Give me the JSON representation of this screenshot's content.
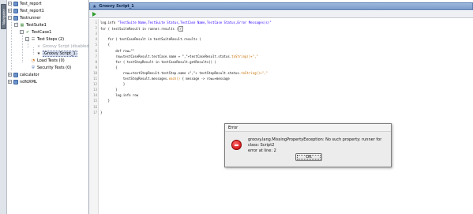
{
  "sidebar": {
    "vertical_tab": "Navigator"
  },
  "tree": {
    "items": [
      {
        "label": "Test_report",
        "icon": "project-icon",
        "expander": "−"
      },
      {
        "label": "Test_report1",
        "icon": "project-icon",
        "expander": "+"
      },
      {
        "label": "Testrunner",
        "icon": "project-icon",
        "expander": "−"
      },
      {
        "label": "TestSuite1",
        "icon": "testsuite-icon",
        "expander": "−"
      },
      {
        "label": "TestCase1",
        "icon": "testcase-icon",
        "expander": "−"
      },
      {
        "label": "Test Steps (2)",
        "icon": "teststeps-icon",
        "expander": "−"
      },
      {
        "label": "Groovy Script (disabled)",
        "icon": "groovy-icon",
        "expander": ""
      },
      {
        "label": "Groovy Script_1",
        "icon": "groovy-icon",
        "expander": ""
      },
      {
        "label": "Load Tests (0)",
        "icon": "loadtest-icon",
        "expander": ""
      },
      {
        "label": "Security Tests (0)",
        "icon": "securitytest-icon",
        "expander": ""
      },
      {
        "label": "calculator",
        "icon": "project-icon",
        "expander": "+"
      },
      {
        "label": "ndfdXML",
        "icon": "project-icon",
        "expander": "+"
      }
    ]
  },
  "editor": {
    "title": "Groovy Script_1",
    "code_lines": [
      {
        "n": "1",
        "pre": "log.info ",
        "str": "\"TestSuite Name,TestSuite Status,TestCase Name,TestCase Status,Error Messages(s)\"",
        "post": ""
      },
      {
        "n": "2",
        "pre": "for ( testSuiteResult in runner.results )",
        "str": "",
        "post": ""
      },
      {
        "n": "3",
        "pre": "",
        "str": "",
        "post": ""
      },
      {
        "n": "4",
        "pre": "    for ( testCaseResult in testSuiteResult.results )",
        "str": "",
        "post": ""
      },
      {
        "n": "5",
        "pre": "    {",
        "str": "",
        "post": ""
      },
      {
        "n": "6",
        "pre": "        def row=\"\"",
        "str": "",
        "post": ""
      },
      {
        "n": "7",
        "pre": "        row=testCaseResult.testCase.name + \",\"+testCaseResult.status.",
        "str": "toString()+\",\"",
        "post": ""
      },
      {
        "n": "8",
        "pre": "        for ( testStepResult in testCaseResult.getResults() )",
        "str": "",
        "post": ""
      },
      {
        "n": "9",
        "pre": "        {",
        "str": "",
        "post": ""
      },
      {
        "n": "10",
        "pre": "            row=+testStepResult.testStep.name +\",\"+ testStepResult.status.",
        "str": "toString()+\",\"",
        "post": ""
      },
      {
        "n": "11",
        "pre": "            testStepResult.messages.",
        "str": "each()",
        "post": " { message -> row=+message"
      },
      {
        "n": "12",
        "pre": "            }",
        "str": "",
        "post": ""
      },
      {
        "n": "13",
        "pre": "        }",
        "str": "",
        "post": ""
      },
      {
        "n": "14",
        "pre": "        log.info row",
        "str": "",
        "post": ""
      },
      {
        "n": "15",
        "pre": "    }",
        "str": "",
        "post": ""
      },
      {
        "n": "16",
        "pre": "",
        "str": "",
        "post": ""
      },
      {
        "n": "17",
        "pre": "}",
        "str": "",
        "post": ""
      }
    ]
  },
  "dialog": {
    "title": "Error",
    "message_line1": "groovy.lang.MissingPropertyException: No such property: runner for class: Script2",
    "message_line2": "error at line: 2",
    "ok_label": "OK"
  }
}
